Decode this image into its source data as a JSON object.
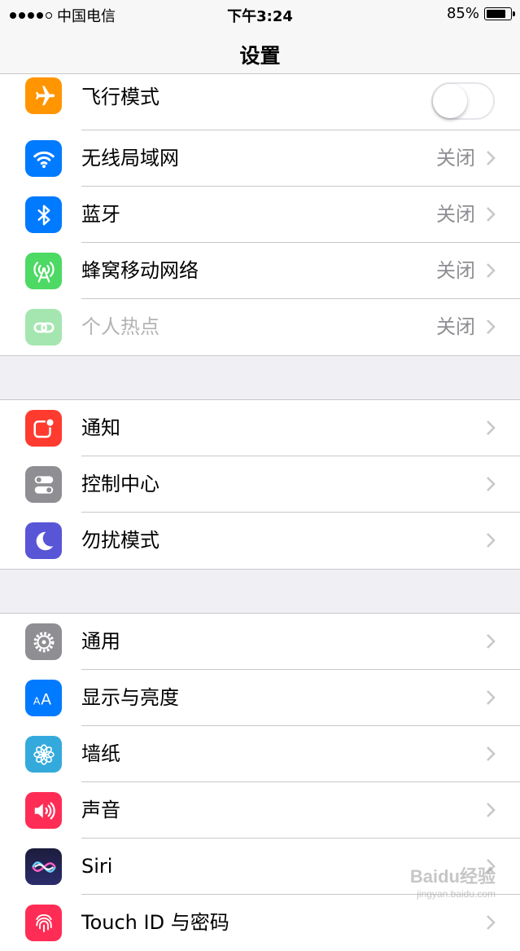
{
  "status_bar": {
    "carrier": "中国电信",
    "time": "下午3:24",
    "battery": "85%",
    "battery_level": 0.85
  },
  "nav": {
    "title": "设置"
  },
  "groups": [
    {
      "rows": [
        {
          "label": "飞行模式",
          "icon": "airplane-icon",
          "color": "#ff9500",
          "toggle": false
        },
        {
          "label": "无线局域网",
          "icon": "wifi-icon",
          "color": "#007aff",
          "value": "关闭"
        },
        {
          "label": "蓝牙",
          "icon": "bluetooth-icon",
          "color": "#007aff",
          "value": "关闭"
        },
        {
          "label": "蜂窝移动网络",
          "icon": "cellular-icon",
          "color": "#4cd964",
          "value": "关闭"
        },
        {
          "label": "个人热点",
          "icon": "hotspot-icon",
          "color": "#a5e6b0",
          "value": "关闭",
          "disabled": true
        }
      ]
    },
    {
      "rows": [
        {
          "label": "通知",
          "icon": "notifications-icon",
          "color": "#ff3b30"
        },
        {
          "label": "控制中心",
          "icon": "control-center-icon",
          "color": "#8e8e93"
        },
        {
          "label": "勿扰模式",
          "icon": "moon-icon",
          "color": "#5856d6"
        }
      ]
    },
    {
      "rows": [
        {
          "label": "通用",
          "icon": "gear-icon",
          "color": "#8e8e93"
        },
        {
          "label": "显示与亮度",
          "icon": "display-icon",
          "color": "#007aff"
        },
        {
          "label": "墙纸",
          "icon": "wallpaper-icon",
          "color": "#34aadc"
        },
        {
          "label": "声音",
          "icon": "speaker-icon",
          "color": "#ff2d55"
        },
        {
          "label": "Siri",
          "icon": "siri-icon",
          "color": "#1c1c3c"
        },
        {
          "label": "Touch ID 与密码",
          "icon": "fingerprint-icon",
          "color": "#ff2d55"
        }
      ]
    }
  ],
  "watermark": {
    "text": "Baidu经验",
    "subtext": "jingyan.baidu.com"
  }
}
